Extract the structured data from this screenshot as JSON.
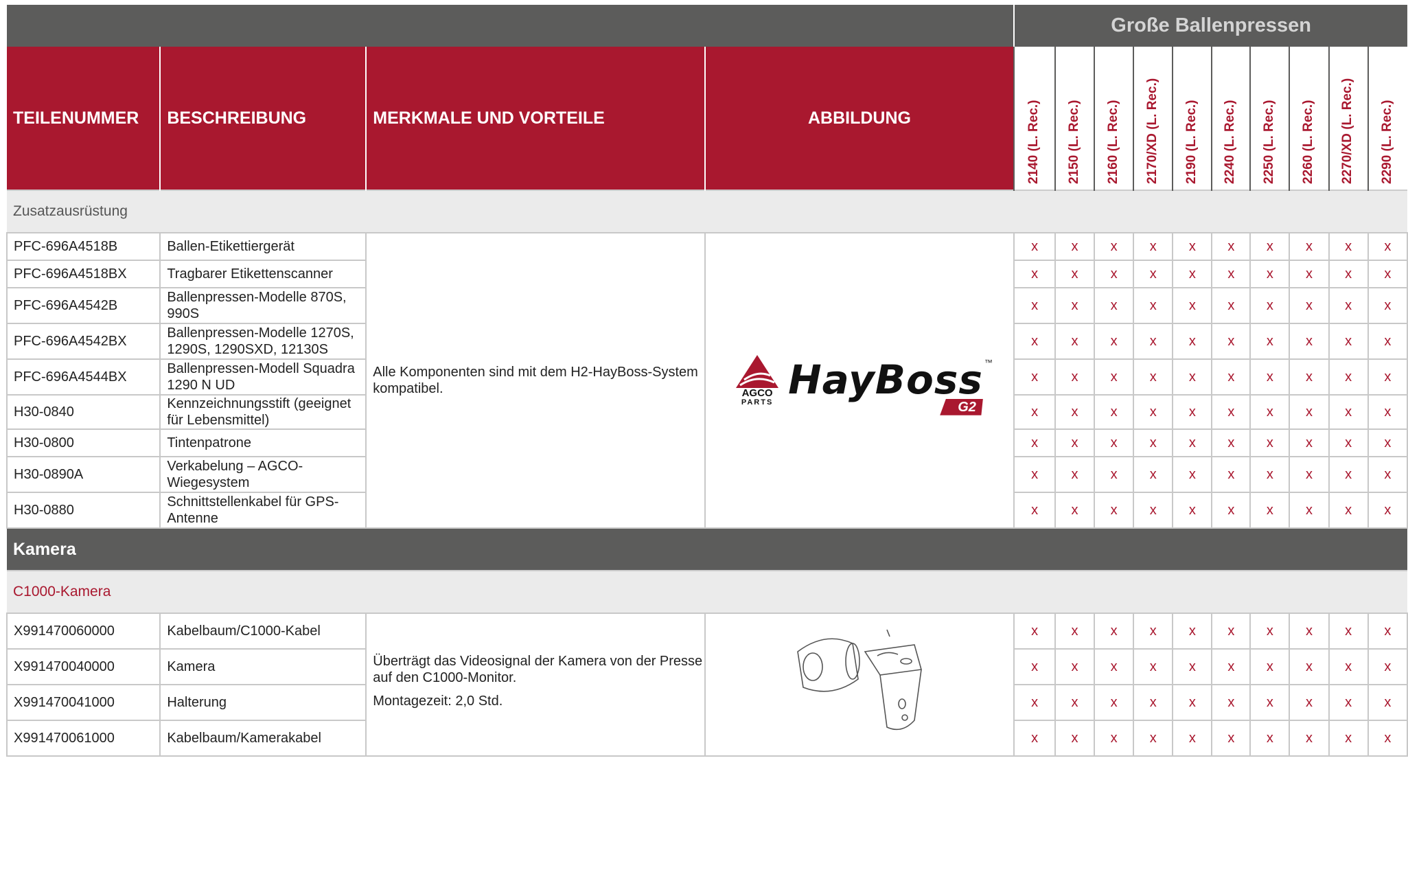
{
  "group_title": "Große Ballenpressen",
  "columns": {
    "part_number": "TEILENUMMER",
    "description": "BESCHREIBUNG",
    "features": "MERKMALE UND VORTEILE",
    "image": "ABBILDUNG"
  },
  "models": [
    "2140 (L. Rec.)",
    "2150 (L. Rec.)",
    "2160 (L. Rec.)",
    "2170/XD (L. Rec.)",
    "2190 (L. Rec.)",
    "2240 (L. Rec.)",
    "2250 (L. Rec.)",
    "2260 (L. Rec.)",
    "2270/XD (L. Rec.)",
    "2290 (L. Rec.)"
  ],
  "mark": "x",
  "section1": {
    "title": "Zusatzausrüstung",
    "features": "Alle Komponenten sind mit dem H2-HayBoss-System kompatibel.",
    "logo": {
      "agco_line1": "AGCO",
      "agco_line2": "PARTS",
      "brand": "HayBoss",
      "tm": "™",
      "badge": "G2"
    },
    "rows": [
      {
        "part": "PFC-696A4518B",
        "desc": "Ballen-Etikettiergerät"
      },
      {
        "part": "PFC-696A4518BX",
        "desc": "Tragbarer Etikettenscanner"
      },
      {
        "part": "PFC-696A4542B",
        "desc": "Ballenpressen-Modelle 870S, 990S"
      },
      {
        "part": "PFC-696A4542BX",
        "desc": "Ballenpressen-Modelle 1270S, 1290S, 1290SXD, 12130S"
      },
      {
        "part": "PFC-696A4544BX",
        "desc": "Ballenpressen-Modell Squadra 1290 N UD"
      },
      {
        "part": "H30-0840",
        "desc": "Kennzeichnungsstift (geeignet für Lebensmittel)"
      },
      {
        "part": "H30-0800",
        "desc": "Tintenpatrone"
      },
      {
        "part": "H30-0890A",
        "desc": "Verkabelung – AGCO-Wiegesystem"
      },
      {
        "part": "H30-0880",
        "desc": "Schnittstellenkabel für GPS-Antenne"
      }
    ]
  },
  "section2": {
    "title": "Kamera",
    "subtitle": "C1000-Kamera",
    "features_1": "Überträgt das Videosignal der Kamera von der Presse auf den C1000-Monitor.",
    "features_2": "Montagezeit: 2,0 Std.",
    "rows": [
      {
        "part": "X991470060000",
        "desc": "Kabelbaum/C1000-Kabel"
      },
      {
        "part": "X991470040000",
        "desc": "Kamera"
      },
      {
        "part": "X991470041000",
        "desc": "Halterung"
      },
      {
        "part": "X991470061000",
        "desc": "Kabelbaum/Kamerakabel"
      }
    ]
  },
  "colors": {
    "accent": "#a9182f",
    "dark_bar": "#5c5c5b",
    "light_bar": "#ebebeb"
  }
}
